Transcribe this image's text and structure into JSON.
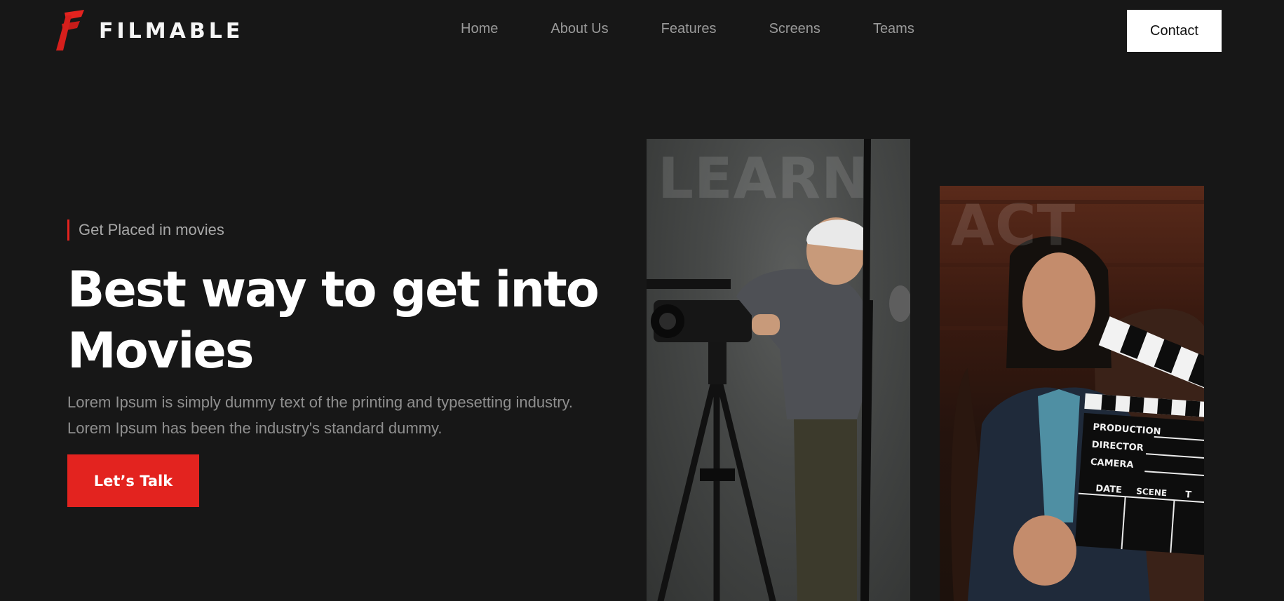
{
  "brand": {
    "name": "FILMABLE",
    "accent": "#e3231f"
  },
  "nav": {
    "items": [
      "Home",
      "About Us",
      "Features",
      "Screens",
      "Teams"
    ],
    "contact_label": "Contact"
  },
  "hero": {
    "eyebrow": "Get Placed in movies",
    "title_line1": "Best way to get into",
    "title_line2": "Movies",
    "desc_line1": "Lorem Ipsum is simply dummy text of the printing and typesetting industry.",
    "desc_line2": "Lorem Ipsum has been the industry's standard dummy.",
    "cta_label": "Let’s Talk"
  },
  "cards": {
    "learn": {
      "word": "LEARN",
      "icon": "camera-tripod-photo"
    },
    "act": {
      "word": "ACT",
      "icon": "clapperboard-photo",
      "slate_production": "PRODUCTION",
      "slate_director": "DIRECTOR",
      "slate_camera": "CAMERA",
      "slate_date": "DATE",
      "slate_scene": "SCENE",
      "slate_take": "T"
    }
  }
}
